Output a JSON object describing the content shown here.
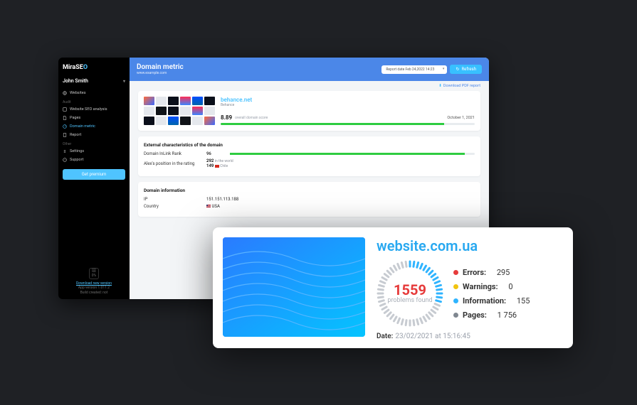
{
  "brand": {
    "name": "MiraSE",
    "accent": "O"
  },
  "user": {
    "name": "John Smith"
  },
  "sidebar": {
    "top": {
      "label": "Websites"
    },
    "groups": [
      {
        "label": "Audit",
        "items": [
          {
            "label": "Website SEO analysis"
          },
          {
            "label": "Pages"
          },
          {
            "label": "Domain metric",
            "active": true
          },
          {
            "label": "Report"
          }
        ]
      },
      {
        "label": "Other",
        "items": [
          {
            "label": "Settings"
          },
          {
            "label": "Support"
          }
        ]
      }
    ],
    "premium_btn": "Get premium",
    "footer": {
      "pct": "0%",
      "download": "Download new version",
      "version": "App version 1.011.2",
      "build": "Build created: not"
    }
  },
  "header": {
    "title": "Domain metric",
    "subtitle": "www.example.com",
    "date_label": "Report date Feb 24,2022 14:23",
    "refresh": "Refresh"
  },
  "pdf_link": "Download PDF report",
  "overview": {
    "domain": "behance.net",
    "domain_sub": "Behance",
    "score": "8.89",
    "score_label": "overall domain score",
    "score_date": "October 1, 2021",
    "score_fill_pct": 88
  },
  "characteristics": {
    "title": "External characteristics of the domain",
    "rows": [
      {
        "k": "Domain InLink Rank",
        "v": "96",
        "fill": 96
      },
      {
        "k": "Alex's position in the rating",
        "v": "292",
        "extra": "in the world",
        "v2": "149",
        "extra2": "Chile"
      }
    ]
  },
  "domain_info": {
    "title": "Domain information",
    "rows": [
      {
        "k": "IP",
        "v": "151.151.113.188"
      },
      {
        "k": "Country",
        "v": "USA"
      }
    ]
  },
  "overlay": {
    "domain": "website.com.ua",
    "gauge_value": "1559",
    "gauge_label": "problems found",
    "stats": {
      "errors": {
        "label": "Errors:",
        "value": "295"
      },
      "warnings": {
        "label": "Warnings:",
        "value": "0"
      },
      "information": {
        "label": "Information:",
        "value": "155"
      },
      "pages": {
        "label": "Pages:",
        "value": "1 756"
      }
    },
    "date_label": "Date:",
    "date_value": "23/02/2021 at 15:16:45"
  }
}
